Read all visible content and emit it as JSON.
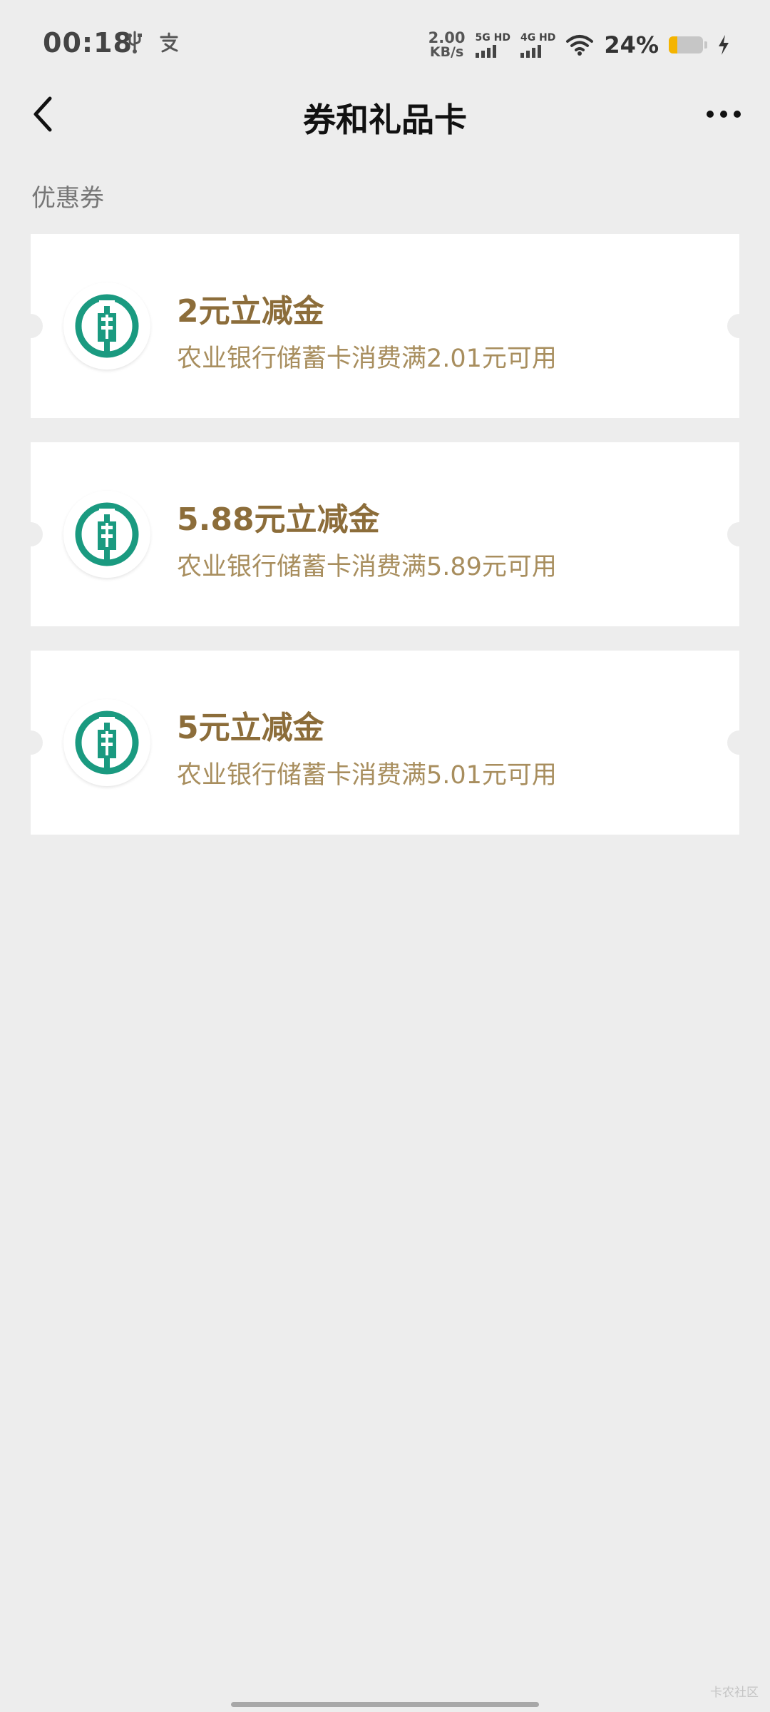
{
  "status_bar": {
    "time": "00:18",
    "net_speed_value": "2.00",
    "net_speed_unit": "KB/s",
    "sim1_label": "5G HD",
    "sim2_label": "4G HD",
    "battery_percent_text": "24%",
    "battery_level": 0.24,
    "icons": [
      "usb-icon",
      "alipay-icon",
      "wifi-icon",
      "charging-bolt-icon"
    ]
  },
  "header": {
    "title": "券和礼品卡"
  },
  "section": {
    "label": "优惠券"
  },
  "coupons": [
    {
      "title": "2元立减金",
      "description": "农业银行储蓄卡消费满2.01元可用"
    },
    {
      "title": "5.88元立减金",
      "description": "农业银行储蓄卡消费满5.89元可用"
    },
    {
      "title": "5元立减金",
      "description": "农业银行储蓄卡消费满5.01元可用"
    }
  ],
  "watermark": "卡农社区",
  "colors": {
    "background": "#ededed",
    "card": "#ffffff",
    "coupon_title": "#8c6d3a",
    "coupon_desc": "#a88e5e",
    "abc_logo_green": "#1a9a80",
    "battery_fill": "#f4b400"
  }
}
